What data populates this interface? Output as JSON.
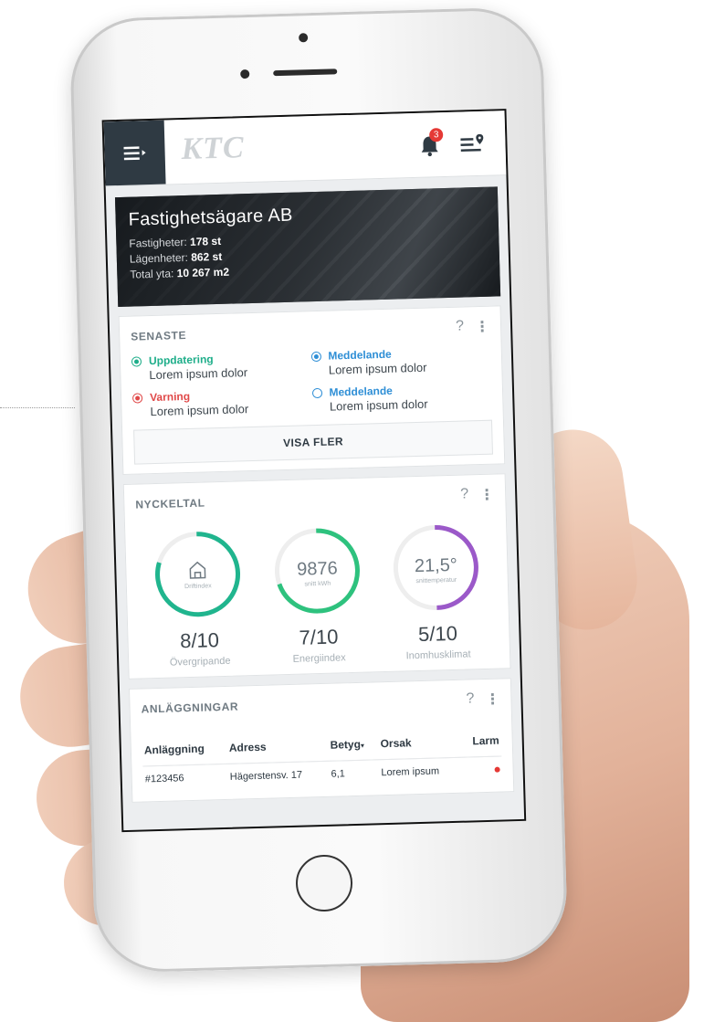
{
  "app": {
    "logo": "KTC",
    "notifications_count": "3"
  },
  "hero": {
    "title": "Fastighetsägare AB",
    "rows": [
      {
        "label": "Fastigheter: ",
        "value": "178 st"
      },
      {
        "label": "Lägenheter: ",
        "value": "862 st"
      },
      {
        "label": "Total yta: ",
        "value": "10 267 m2"
      }
    ]
  },
  "latest": {
    "title": "SENASTE",
    "help": "?",
    "items": [
      {
        "type": "Uppdatering",
        "text": "Lorem ipsum dolor",
        "color": "#1fae8a",
        "filled": true
      },
      {
        "type": "Meddelande",
        "text": "Lorem ipsum dolor",
        "color": "#2f8fd6",
        "filled": true
      },
      {
        "type": "Varning",
        "text": "Lorem ipsum dolor",
        "color": "#e04848",
        "filled": true
      },
      {
        "type": "Meddelande",
        "text": "Lorem ipsum dolor",
        "color": "#2f8fd6",
        "filled": false
      }
    ],
    "show_more": "VISA FLER"
  },
  "kpis": {
    "title": "NYCKELTAL",
    "help": "?",
    "items": [
      {
        "center_value": "",
        "center_label": "Driftindex",
        "icon": "home-icon",
        "score": "8/10",
        "label": "Övergripande",
        "fill": 0.8,
        "color": "#20b58e"
      },
      {
        "center_value": "9876",
        "center_label": "snitt kWh",
        "icon": "",
        "score": "7/10",
        "label": "Energiindex",
        "fill": 0.7,
        "color": "#2ec27e"
      },
      {
        "center_value": "21,5°",
        "center_label": "snittemperatur",
        "icon": "",
        "score": "5/10",
        "label": "Inomhusklimat",
        "fill": 0.5,
        "color": "#9b59c9"
      }
    ]
  },
  "facilities": {
    "title": "ANLÄGGNINGAR",
    "help": "?",
    "columns": [
      "Anläggning",
      "Adress",
      "Betyg",
      "Orsak",
      "Larm"
    ],
    "rows": [
      {
        "id": "#123456",
        "address": "Hägerstensv. 17",
        "score": "6,1",
        "reason": "Lorem ipsum",
        "alarm_color": "#e53935"
      }
    ]
  }
}
